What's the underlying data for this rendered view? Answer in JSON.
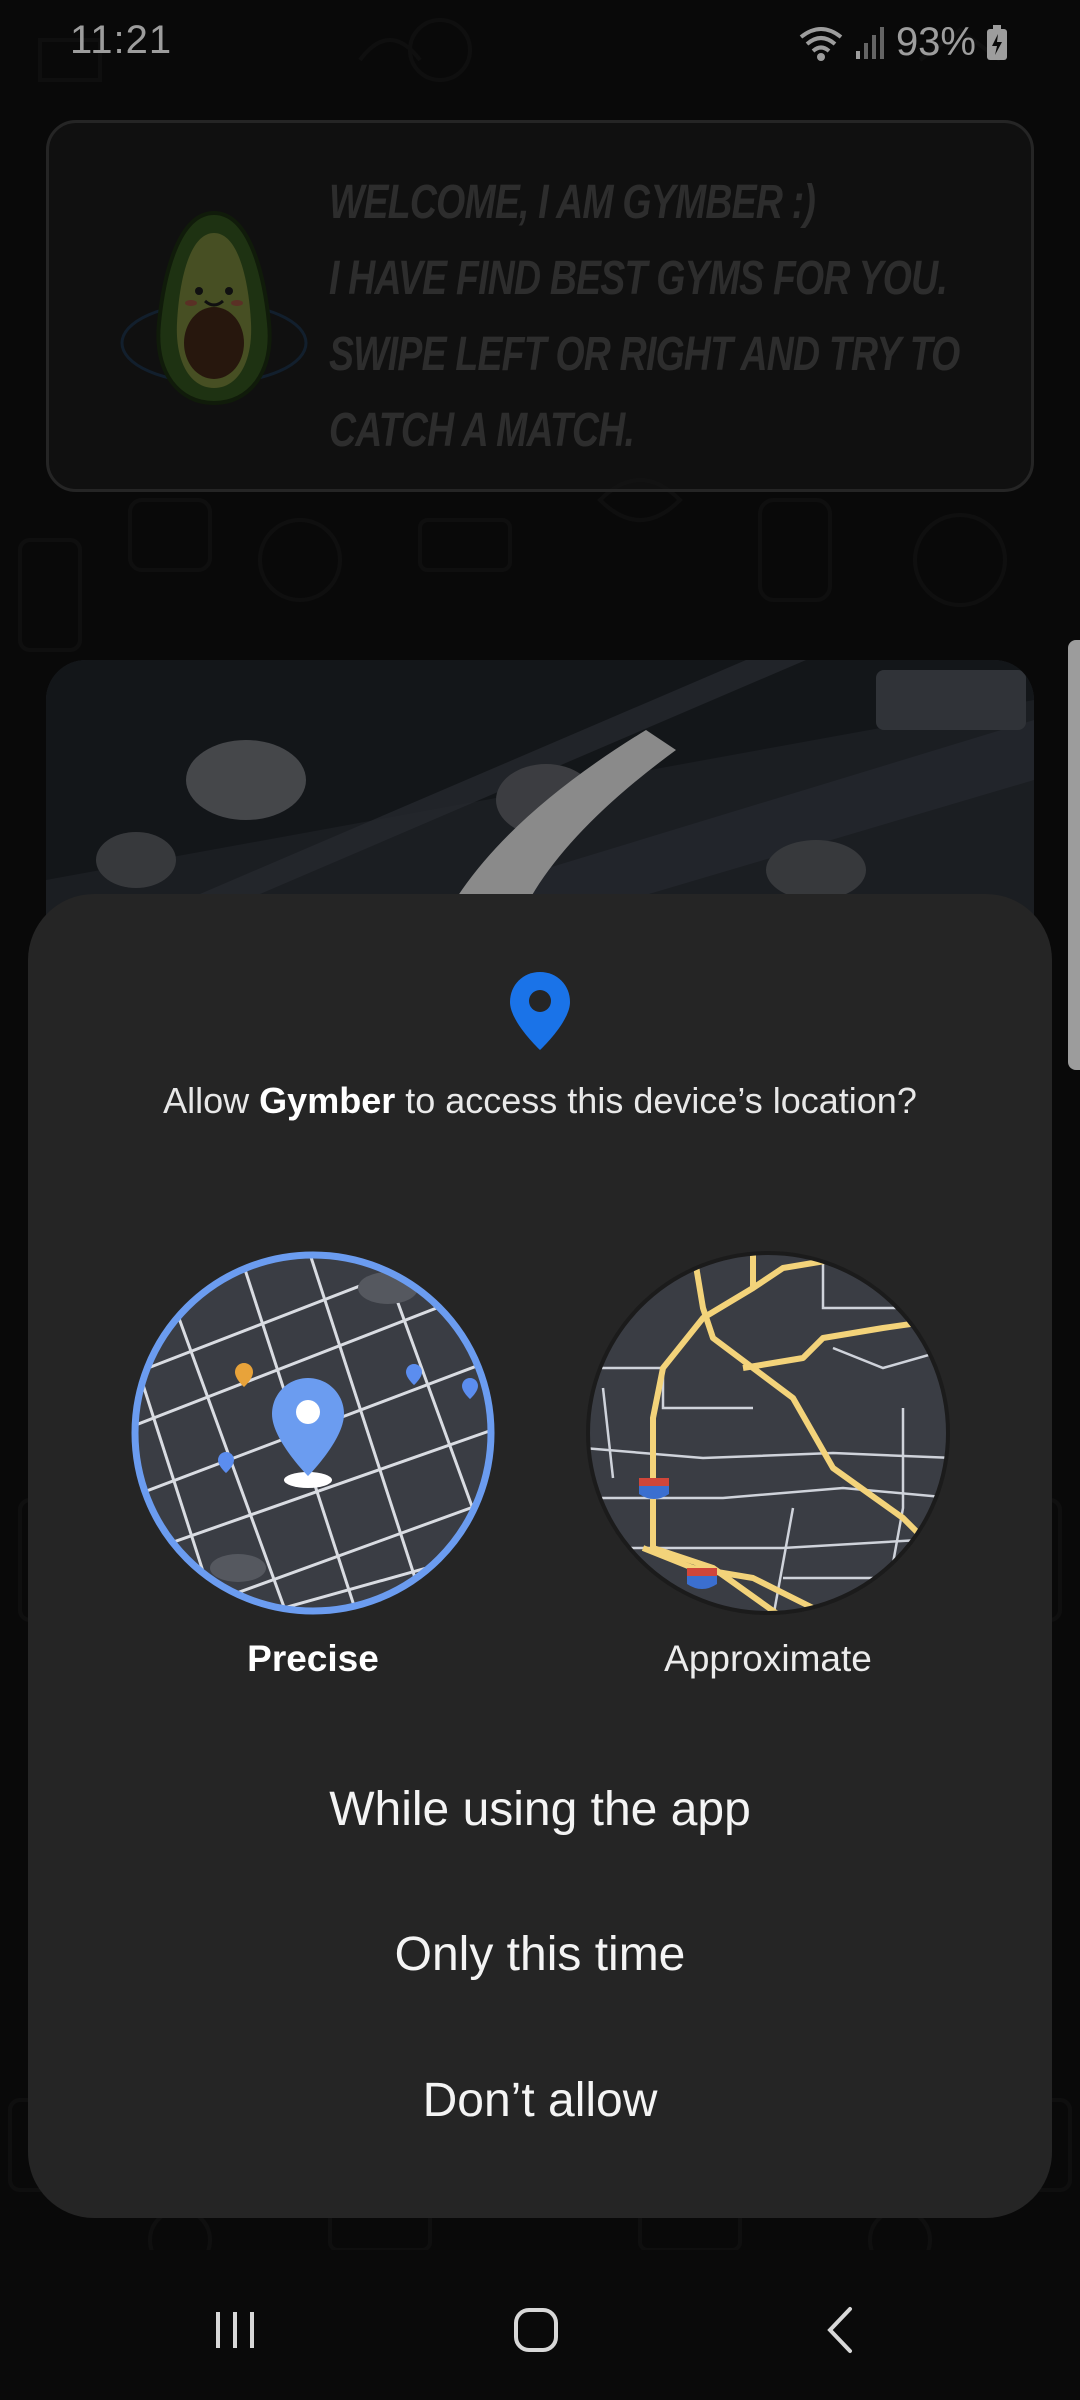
{
  "status_bar": {
    "time": "11:21",
    "battery": "93%",
    "icons": [
      "wifi-icon",
      "signal-icon",
      "battery-charging-icon"
    ]
  },
  "welcome_banner": {
    "lines": [
      "WELCOME, I AM GYMBER :)",
      "I HAVE FIND BEST GYMS FOR YOU.",
      "SWIPE LEFT OR RIGHT AND TRY TO",
      "CATCH A MATCH."
    ],
    "mascot": "avocado-mascot"
  },
  "permission_dialog": {
    "icon": "location-pin-icon",
    "title_prefix": "Allow ",
    "app_name": "Gymber",
    "title_suffix": " to access this device’s location?",
    "options": {
      "precise": "Precise",
      "approximate": "Approximate",
      "selected": "precise"
    },
    "buttons": {
      "while_using": "While using the app",
      "only_this_time": "Only this time",
      "dont_allow": "Don’t allow"
    }
  },
  "nav_bar": {
    "buttons": [
      "recents-icon",
      "home-icon",
      "back-icon"
    ]
  },
  "colors": {
    "accent_blue": "#1a73e8",
    "dialog_bg": "#252525",
    "map_road_yellow": "#f3d37a",
    "precise_ring": "#6b9cf0"
  }
}
